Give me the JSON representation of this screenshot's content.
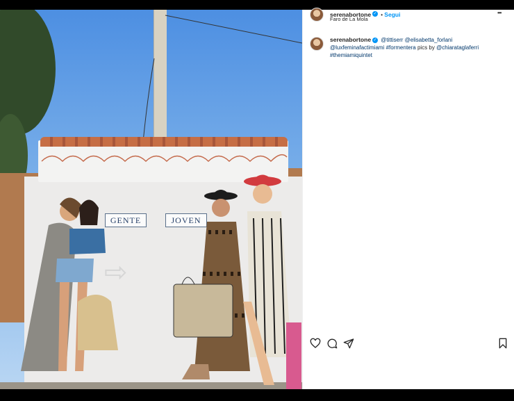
{
  "post": {
    "username": "serenabortone",
    "follow_label": "Segui",
    "location": "Faro de La Mola",
    "more_label": "•••",
    "caption": {
      "username": "serenabortone",
      "mentions": [
        "@tittiserr",
        "@elisabetta_forlani",
        "@luxfeminafactimiami"
      ],
      "hashtag_1": "#formentera",
      "text_pics_by": " pics by ",
      "mention_photographer": "@chiarataglaferri",
      "hashtag_2": "#themiamiquintet"
    }
  },
  "photo": {
    "sign_left": "GENTE",
    "sign_right": "JOVEN"
  },
  "actions": {
    "like": "heart-icon",
    "comment": "comment-icon",
    "share": "share-icon",
    "save": "bookmark-icon"
  }
}
